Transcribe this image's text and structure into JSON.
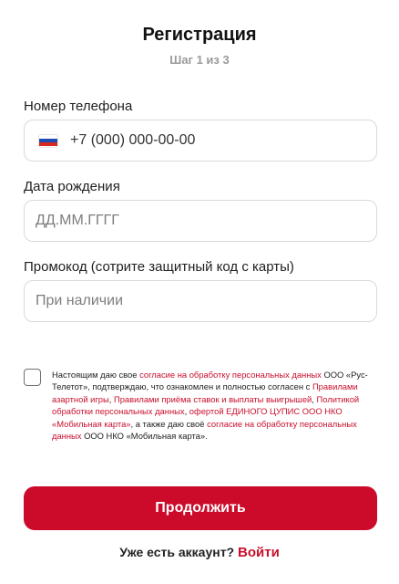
{
  "header": {
    "title": "Регистрация",
    "step": "Шаг 1 из 3"
  },
  "phone": {
    "label": "Номер телефона",
    "flag_icon": "russia-flag-icon",
    "placeholder": "+7 (000) 000-00-00"
  },
  "birthdate": {
    "label": "Дата рождения",
    "placeholder": "ДД.ММ.ГГГГ"
  },
  "promo": {
    "label": "Промокод (сотрите защитный код с карты)",
    "placeholder": "При наличии"
  },
  "consent": {
    "checked": false,
    "t1": "Настоящим даю свое ",
    "link1": "согласие на обработку персональных данных",
    "t2": " ООО «Рус-Телетот», подтверждаю, что ознакомлен и полностью согласен с ",
    "link2": "Правилами азартной игры",
    "t3": ", ",
    "link3": "Правилами приёма ставок и выплаты выигрышей",
    "t4": ", ",
    "link4": "Политикой обработки персональных данных",
    "t5": ", ",
    "link5": "офертой ЕДИНОГО ЦУПИС ООО НКО «Мобильная карта»",
    "t6": ", а также даю своё ",
    "link6": "согласие на обработку персональных данных",
    "t7": " ООО НКО «Мобильная карта»."
  },
  "continue_label": "Продолжить",
  "login": {
    "question": "Уже есть аккаунт?",
    "link": "Войти"
  },
  "colors": {
    "accent": "#cc0a2a",
    "link": "#c8102e",
    "border": "#d9d9d9",
    "muted": "#9a9a9a"
  }
}
